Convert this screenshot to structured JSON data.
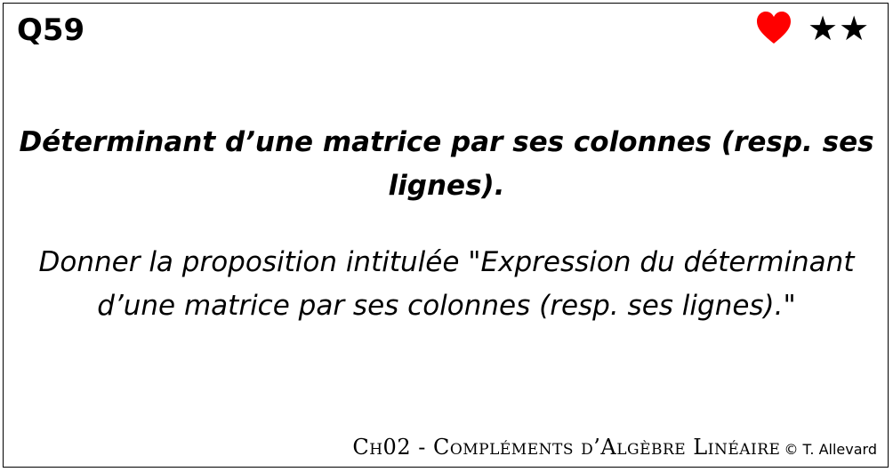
{
  "card": {
    "question_id": "Q59",
    "stars": "★★",
    "title": "Déterminant d’une matrice par ses colonnes (resp. ses lignes).",
    "prompt": "Donner la proposition intitulée \"Expression du déterminant d’une matrice par ses colonnes (resp. ses lignes).\"",
    "chapter": "Ch02 - Compléments d’Algèbre Linéaire",
    "copyright": "© T. Allevard"
  },
  "colors": {
    "heart": "#ff0000",
    "text": "#000000",
    "border": "#000000"
  },
  "icons": {
    "heart": "heart-icon",
    "stars": "star-icon"
  }
}
